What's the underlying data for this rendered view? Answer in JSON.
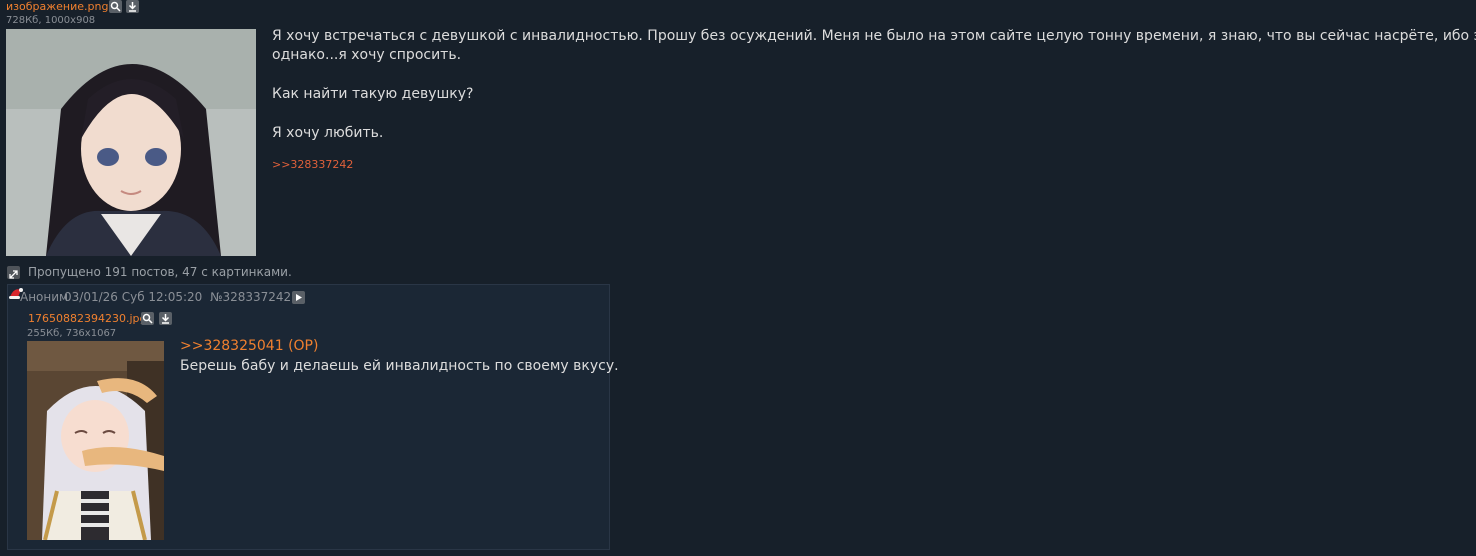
{
  "op": {
    "file_name": "изображение.png",
    "file_meta": "728Кб, 1000x908",
    "text_lines": [
      "Я хочу встречаться с девушкой с инвалидностью. Прошу без осуждений. Меня не было на этом сайте целую тонну времени, я знаю, что вы сейчас насрёте, ибо это /b/,",
      "однако...я хочу спросить."
    ],
    "question": "Как найти такую девушку?",
    "love": "Я хочу любить.",
    "reply_ref": ">>328337242"
  },
  "omitted": "Пропущено 191 постов, 47 с картинками.",
  "reply": {
    "author": "Аноним",
    "datetime": "03/01/26 Суб 12:05:20",
    "post_number": "№328337242",
    "file_name": "17650882394230.jpg",
    "file_meta": "255Кб, 736x1067",
    "quote_link": ">>328325041 (OP)",
    "text": "Берешь бабу и делаешь ей инвалидность по своему вкусу."
  },
  "colors": {
    "accent": "#f0802f",
    "background": "#17202a",
    "reply_bg": "#1b2735"
  },
  "icons": [
    "search-icon",
    "download-icon",
    "expand-icon",
    "play-icon",
    "santa-hat-icon"
  ]
}
